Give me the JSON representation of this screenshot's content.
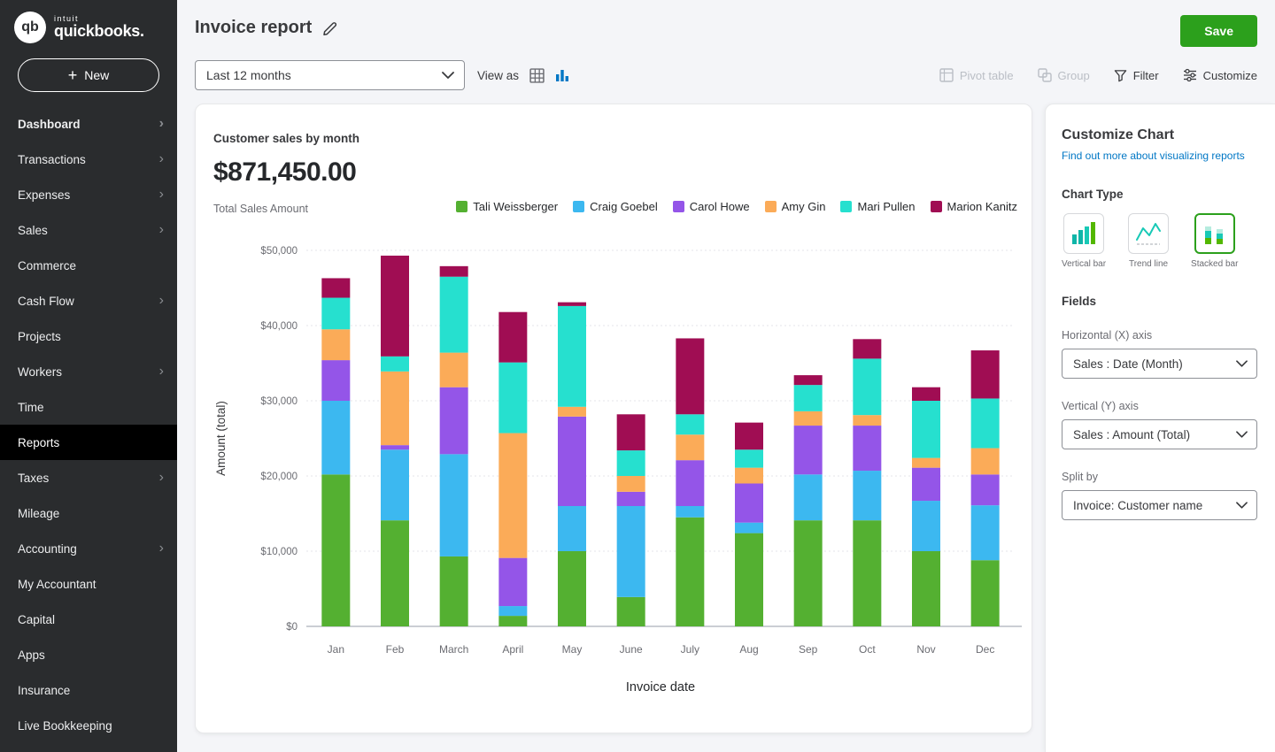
{
  "colors": {
    "accent_green": "#2ca01c",
    "link_blue": "#0077c5",
    "sidebar_bg": "#2a2c2e",
    "selected_nav_bg": "#000000"
  },
  "sidebar": {
    "logo": {
      "brand_small": "intuit",
      "brand": "quickbooks."
    },
    "new_button_label": "New",
    "items": [
      {
        "label": "Dashboard",
        "chevron": true,
        "bold": true
      },
      {
        "label": "Transactions",
        "chevron": true
      },
      {
        "label": "Expenses",
        "chevron": true
      },
      {
        "label": "Sales",
        "chevron": true
      },
      {
        "label": "Commerce"
      },
      {
        "label": "Cash Flow",
        "chevron": true
      },
      {
        "label": "Projects"
      },
      {
        "label": "Workers",
        "chevron": true
      },
      {
        "label": "Time"
      },
      {
        "label": "Reports",
        "selected": true
      },
      {
        "label": "Taxes",
        "chevron": true
      },
      {
        "label": "Mileage"
      },
      {
        "label": "Accounting",
        "chevron": true
      },
      {
        "label": "My Accountant"
      },
      {
        "label": "Capital"
      },
      {
        "label": "Apps"
      },
      {
        "label": "Insurance"
      },
      {
        "label": "Live Bookkeeping"
      }
    ]
  },
  "header": {
    "title": "Invoice report",
    "save_label": "Save"
  },
  "toolbar": {
    "period_value": "Last 12 months",
    "view_as_label": "View as",
    "pivot_label": "Pivot table",
    "group_label": "Group",
    "filter_label": "Filter",
    "customize_label": "Customize"
  },
  "chart_card": {
    "title": "Customer sales by month",
    "total_amount": "$871,450.00",
    "total_label": "Total Sales Amount"
  },
  "chart_data": {
    "type": "bar",
    "stacked": true,
    "title": "Customer sales by month",
    "categories": [
      "Jan",
      "Feb",
      "March",
      "April",
      "May",
      "June",
      "July",
      "Aug",
      "Sep",
      "Oct",
      "Nov",
      "Dec"
    ],
    "series": [
      {
        "name": "Tali Weissberger",
        "color": "#54b031",
        "values": [
          20200,
          14100,
          9300,
          1400,
          10000,
          3900,
          14500,
          12400,
          14100,
          14100,
          10000,
          8800
        ]
      },
      {
        "name": "Craig Goebel",
        "color": "#3cb8f0",
        "values": [
          9800,
          9400,
          13600,
          1300,
          6000,
          12100,
          1500,
          1400,
          6100,
          6600,
          6700,
          7300
        ]
      },
      {
        "name": "Carol Howe",
        "color": "#9455e8",
        "values": [
          5400,
          600,
          8900,
          6400,
          11900,
          1900,
          6100,
          5200,
          6500,
          6000,
          4400,
          4100
        ]
      },
      {
        "name": "Amy Gin",
        "color": "#fbab58",
        "values": [
          4100,
          9800,
          4600,
          16600,
          1300,
          2100,
          3400,
          2100,
          1900,
          1400,
          1300,
          3500
        ]
      },
      {
        "name": "Mari Pullen",
        "color": "#26e0cf",
        "values": [
          4200,
          2000,
          10100,
          9400,
          13400,
          3400,
          2700,
          2400,
          3500,
          7500,
          7600,
          6600
        ]
      },
      {
        "name": "Marion Kanitz",
        "color": "#a00d53",
        "values": [
          2600,
          13400,
          1400,
          6700,
          500,
          4800,
          10100,
          3600,
          1300,
          2600,
          1800,
          6400
        ]
      }
    ],
    "xlabel": "Invoice date",
    "ylabel": "Amount (total)",
    "ylim": [
      0,
      50000
    ],
    "yticks": [
      "$0",
      "$10,000",
      "$20,000",
      "$30,000",
      "$40,000",
      "$50,000"
    ],
    "grid": "dashed horizontal",
    "legend_position": "top-right"
  },
  "customize_panel": {
    "title": "Customize Chart",
    "link_label": "Find out more about visualizing reports",
    "chart_type_label": "Chart Type",
    "chart_types": [
      {
        "label": "Vertical bar",
        "icon": "vertical-bar-icon",
        "selected": false
      },
      {
        "label": "Trend line",
        "icon": "trend-line-icon",
        "selected": false
      },
      {
        "label": "Stacked bar",
        "icon": "stacked-bar-icon",
        "selected": true
      }
    ],
    "fields_label": "Fields",
    "x_axis": {
      "label": "Horizontal (X) axis",
      "value": "Sales : Date (Month)"
    },
    "y_axis": {
      "label": "Vertical (Y) axis",
      "value": "Sales : Amount (Total)"
    },
    "split_by": {
      "label": "Split by",
      "value": "Invoice: Customer name"
    }
  }
}
